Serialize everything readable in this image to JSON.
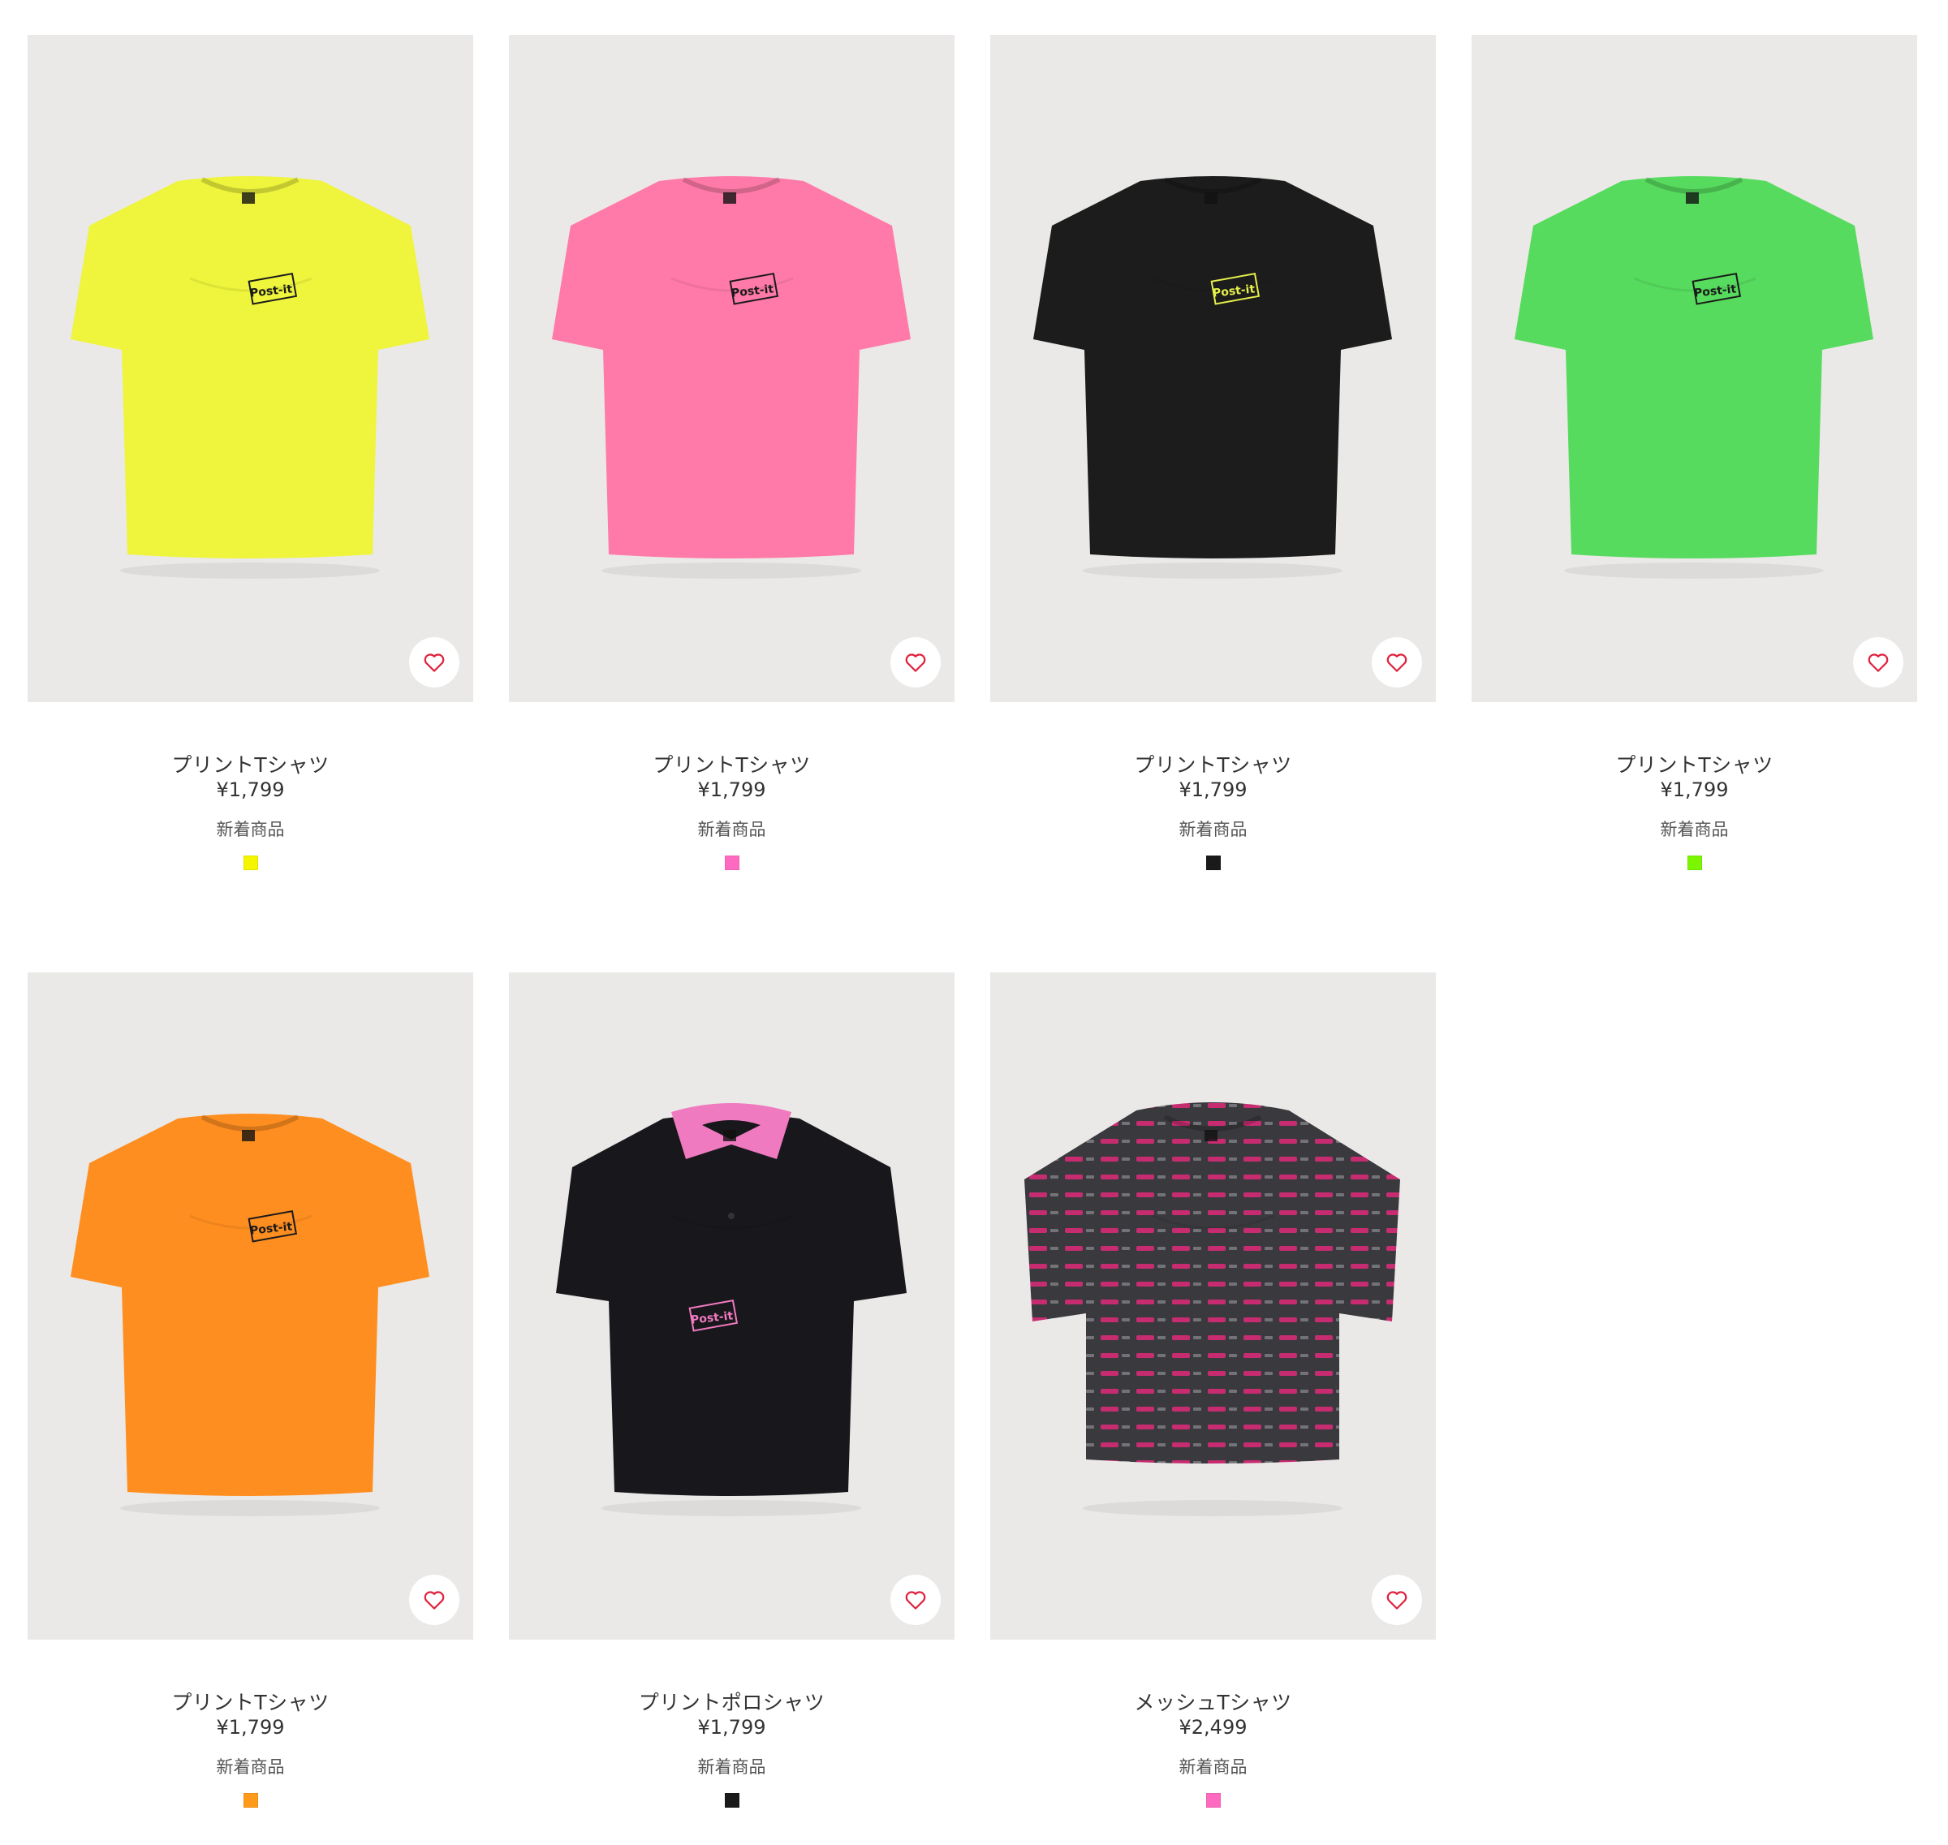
{
  "products": [
    {
      "name": "プリントTシャツ",
      "price": "¥1,799",
      "badge": "新着商品",
      "shirt_color": "#eef53c",
      "logo_color": "#1a1a1a",
      "swatch_color": "#f5f500",
      "collar_color": "#eef53c",
      "style": "tee"
    },
    {
      "name": "プリントTシャツ",
      "price": "¥1,799",
      "badge": "新着商品",
      "shirt_color": "#ff7aa8",
      "logo_color": "#1a1a1a",
      "swatch_color": "#ff6ac1",
      "collar_color": "#ff7aa8",
      "style": "tee"
    },
    {
      "name": "プリントTシャツ",
      "price": "¥1,799",
      "badge": "新着商品",
      "shirt_color": "#1c1c1c",
      "logo_color": "#e6f04a",
      "swatch_color": "#1a1a1a",
      "collar_color": "#1c1c1c",
      "style": "tee"
    },
    {
      "name": "プリントTシャツ",
      "price": "¥1,799",
      "badge": "新着商品",
      "shirt_color": "#57db5e",
      "logo_color": "#1a1a1a",
      "swatch_color": "#7cf600",
      "collar_color": "#57db5e",
      "style": "tee"
    },
    {
      "name": "プリントTシャツ",
      "price": "¥1,799",
      "badge": "新着商品",
      "shirt_color": "#ff8e20",
      "logo_color": "#1a1a1a",
      "swatch_color": "#ff9a1a",
      "collar_color": "#ff8e20",
      "style": "tee"
    },
    {
      "name": "プリントポロシャツ",
      "price": "¥1,799",
      "badge": "新着商品",
      "shirt_color": "#18181c",
      "logo_color": "#f07ac0",
      "swatch_color": "#1a1a1a",
      "collar_color": "#f07ac0",
      "style": "polo"
    },
    {
      "name": "メッシュTシャツ",
      "price": "¥2,499",
      "badge": "新着商品",
      "shirt_color": "#3a3a3e",
      "logo_color": "#e0297a",
      "swatch_color": "#ff6ac1",
      "collar_color": "#2a2a2e",
      "style": "mesh"
    }
  ],
  "logo_text": "Post-it",
  "heart_color": "#e0213d"
}
